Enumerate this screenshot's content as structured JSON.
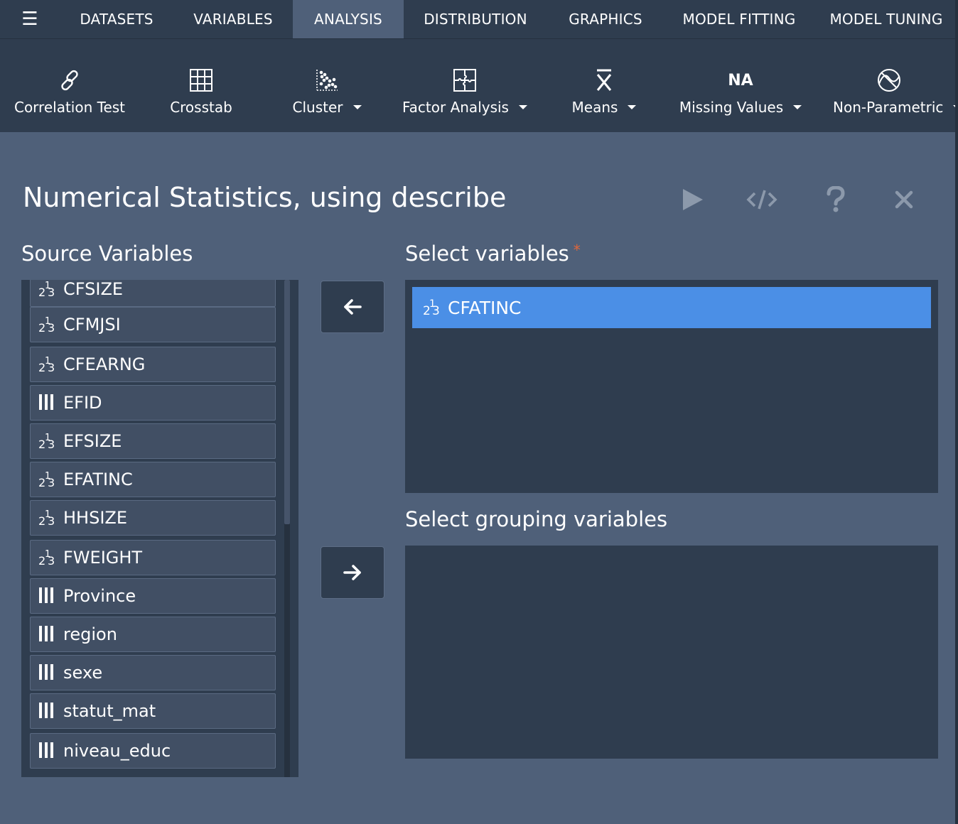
{
  "nav": {
    "menu_icon": "hamburger-menu-icon",
    "tabs": [
      {
        "label": "DATASETS",
        "active": false
      },
      {
        "label": "VARIABLES",
        "active": false
      },
      {
        "label": "ANALYSIS",
        "active": true
      },
      {
        "label": "DISTRIBUTION",
        "active": false
      },
      {
        "label": "GRAPHICS",
        "active": false
      },
      {
        "label": "MODEL FITTING",
        "active": false
      },
      {
        "label": "MODEL TUNING",
        "active": false
      }
    ]
  },
  "ribbon": {
    "items": [
      {
        "label": "Correlation Test",
        "icon": "link-icon",
        "dropdown": false
      },
      {
        "label": "Crosstab",
        "icon": "grid-icon",
        "dropdown": false
      },
      {
        "label": "Cluster",
        "icon": "scatter-cluster-icon",
        "dropdown": true
      },
      {
        "label": "Factor Analysis",
        "icon": "puzzle-icon",
        "dropdown": true
      },
      {
        "label": "Means",
        "icon": "x-bar-icon",
        "dropdown": true
      },
      {
        "label": "Missing Values",
        "icon": "na-icon",
        "icon_text": "NA",
        "dropdown": true
      },
      {
        "label": "Non-Parametric",
        "icon": "non-parametric-icon",
        "dropdown": true
      }
    ]
  },
  "dialog": {
    "title": "Numerical Statistics, using describe",
    "actions": [
      "run-icon",
      "code-icon",
      "help-icon",
      "close-icon"
    ],
    "source_label": "Source Variables",
    "selected_label": "Select variables",
    "required_marker": "*",
    "grouping_label": "Select grouping variables"
  },
  "source_variables": [
    {
      "name": "CFSIZE",
      "type": "numeric"
    },
    {
      "name": "CFMJSI",
      "type": "numeric"
    },
    {
      "name": "CFEARNG",
      "type": "numeric"
    },
    {
      "name": "EFID",
      "type": "factor"
    },
    {
      "name": "EFSIZE",
      "type": "numeric"
    },
    {
      "name": "EFATINC",
      "type": "numeric"
    },
    {
      "name": "HHSIZE",
      "type": "numeric"
    },
    {
      "name": "FWEIGHT",
      "type": "numeric"
    },
    {
      "name": "Province",
      "type": "factor"
    },
    {
      "name": "region",
      "type": "factor"
    },
    {
      "name": "sexe",
      "type": "factor"
    },
    {
      "name": "statut_mat",
      "type": "factor"
    },
    {
      "name": "niveau_educ",
      "type": "factor"
    }
  ],
  "selected_variables": [
    {
      "name": "CFATINC",
      "type": "numeric"
    }
  ],
  "grouping_variables": [],
  "icon_glyphs": {
    "numeric_sup": "1",
    "numeric_base_left": "2",
    "numeric_base_right": "3"
  },
  "colors": {
    "topbar": "#2f3d4f",
    "panel": "#4f6079",
    "box": "#2f3d4f",
    "item": "#414f64",
    "selected": "#4b8fe6",
    "required": "#e0663a"
  }
}
